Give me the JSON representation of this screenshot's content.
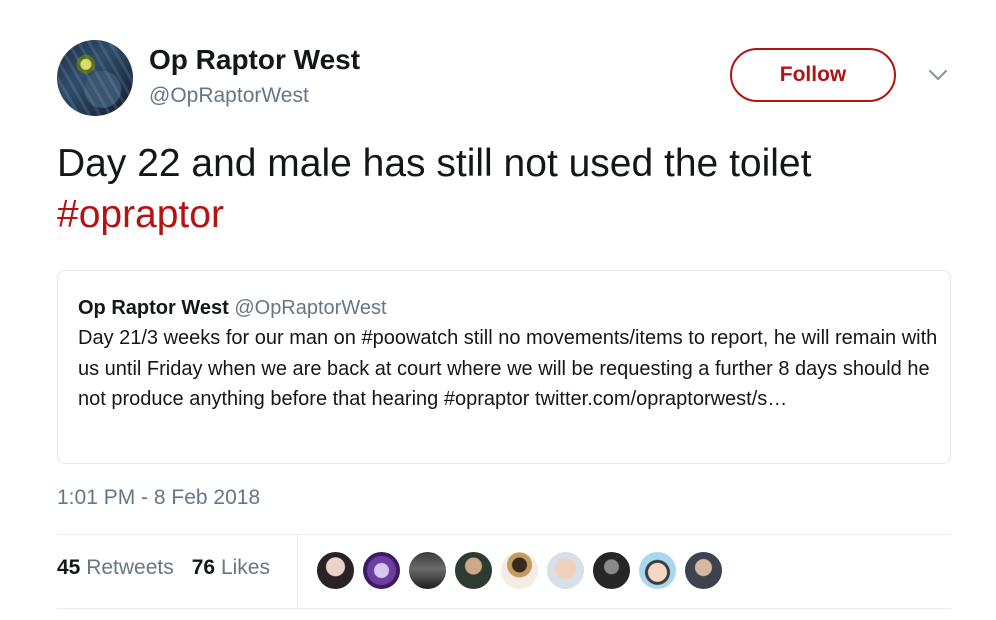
{
  "author": {
    "name": "Op Raptor West",
    "handle": "@OpRaptorWest",
    "follow_label": "Follow"
  },
  "tweet": {
    "text": "Day 22 and male has still not used the toilet",
    "hashtag": "#opraptor",
    "timestamp": "1:01 PM - 8 Feb 2018"
  },
  "quoted_tweet": {
    "name": "Op Raptor West",
    "handle": "@OpRaptorWest",
    "text": "Day 21/3 weeks for our man on #poowatch still no movements/items to report, he will remain with us until Friday when we are back at court where we will be requesting a further 8 days should he not produce anything before that hearing #opraptor twitter.com/opraptorwest/s…"
  },
  "stats": {
    "retweets_count": "45",
    "retweets_label": "Retweets",
    "likes_count": "76",
    "likes_label": "Likes"
  },
  "colors": {
    "accent": "#b31312",
    "secondary_text": "#657786",
    "border": "#e1e8ed"
  },
  "icons": {
    "caret": "chevron-down-icon"
  }
}
